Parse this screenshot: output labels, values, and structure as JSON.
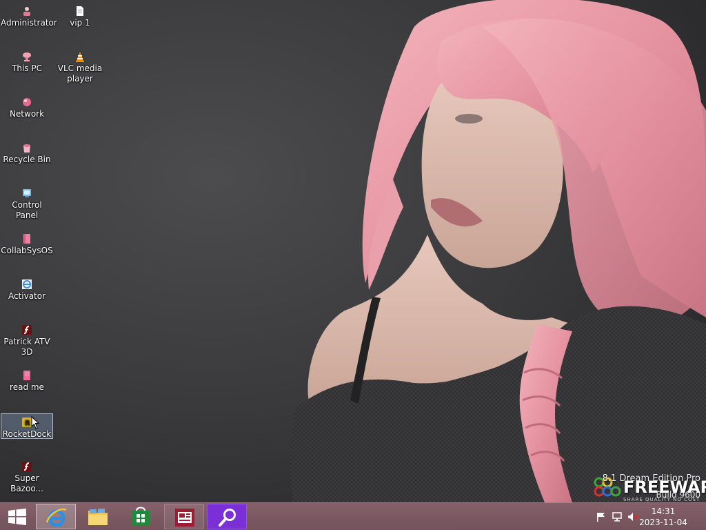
{
  "desktop_icons": [
    {
      "label": "Administrator",
      "icon": "user-folder-icon"
    },
    {
      "label": "vip 1",
      "icon": "text-document-icon"
    },
    {
      "label": "This PC",
      "icon": "computer-icon"
    },
    {
      "label": "VLC media player",
      "icon": "vlc-cone-icon"
    },
    {
      "label": "Network",
      "icon": "network-icon"
    },
    {
      "label": "Recycle Bin",
      "icon": "recycle-bin-icon"
    },
    {
      "label": "Control Panel",
      "icon": "control-panel-icon"
    },
    {
      "label": "CollabSysOS",
      "icon": "pink-book-icon"
    },
    {
      "label": "Activator",
      "icon": "ie-shortcut-icon"
    },
    {
      "label": "Patrick ATV 3D",
      "icon": "flash-icon"
    },
    {
      "label": "read me",
      "icon": "pink-document-icon"
    },
    {
      "label": "RocketDock",
      "icon": "rocketdock-icon"
    },
    {
      "label": "Super Bazoo...",
      "icon": "flash-icon"
    }
  ],
  "watermark": {
    "edition": "8.1 Dream Edition Pro",
    "brand": "FREEWARE",
    "build": "Build 9600",
    "tagline": "SHARE QUALITY NO COST"
  },
  "taskbar": {
    "start_icon": "windows-logo-icon",
    "items": [
      {
        "name": "Internet Explorer",
        "icon": "internet-explorer-icon",
        "state": "active"
      },
      {
        "name": "File Explorer",
        "icon": "file-explorer-icon",
        "state": "normal"
      },
      {
        "name": "Store",
        "icon": "store-icon",
        "state": "normal"
      },
      {
        "name": "News",
        "icon": "news-icon",
        "state": "pinned"
      },
      {
        "name": "Search",
        "icon": "search-icon",
        "state": "pinned"
      }
    ],
    "tray": {
      "icons": [
        "action-center-flag-icon",
        "network-tray-icon",
        "volume-muted-icon"
      ],
      "time": "14:31",
      "date": "2023-11-04"
    }
  },
  "colors": {
    "taskbar": "#7a5660",
    "selection": "#8c9bb5",
    "hair_pink": "#e89aa5",
    "sweater": "#3a3a3c"
  }
}
